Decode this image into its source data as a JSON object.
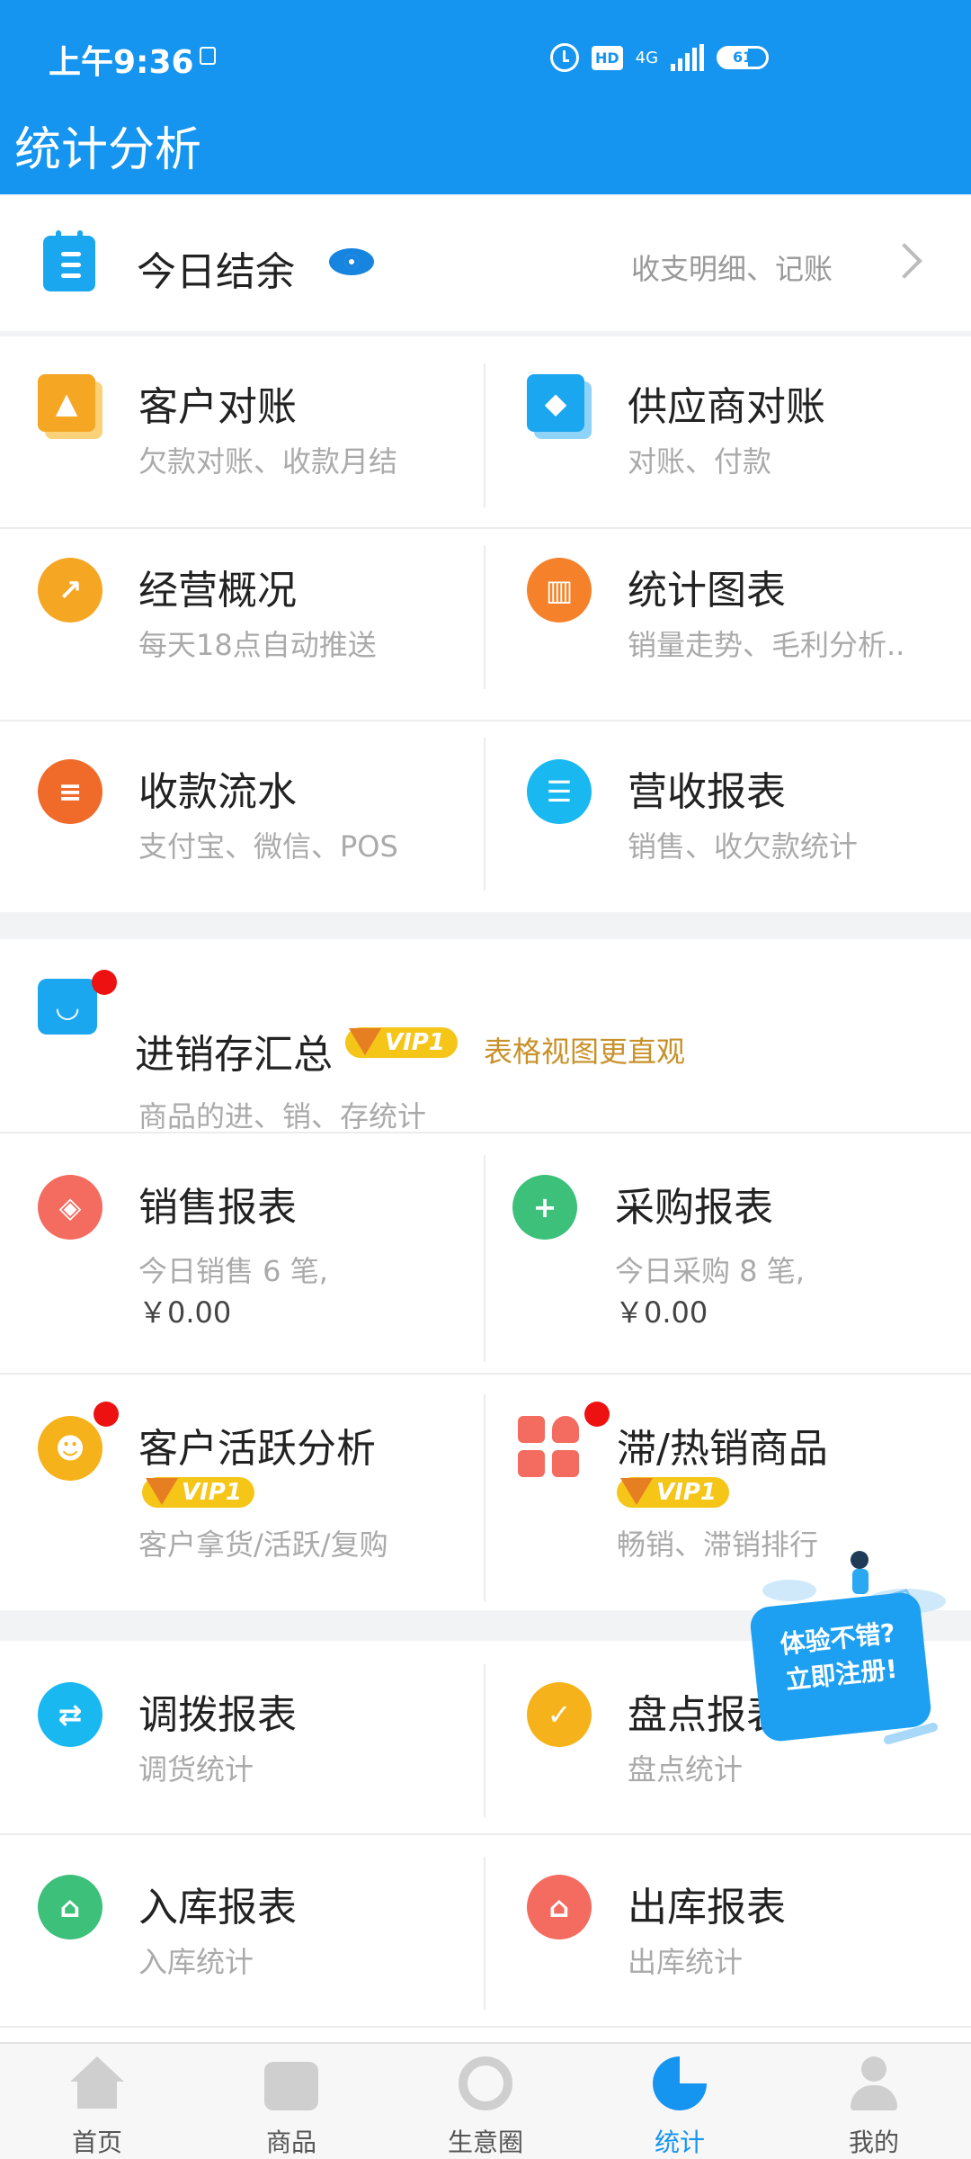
{
  "status_bar": {
    "time": "上午9:36",
    "hd": "HD",
    "network": "4G",
    "battery": "61"
  },
  "header": {
    "title": "统计分析"
  },
  "today": {
    "title": "今日结余",
    "subtitle": "收支明细、记账"
  },
  "grid1": [
    {
      "title": "客户对账",
      "subtitle": "欠款对账、收款月结"
    },
    {
      "title": "供应商对账",
      "subtitle": "对账、付款"
    },
    {
      "title": "经营概况",
      "subtitle": "每天18点自动推送"
    },
    {
      "title": "统计图表",
      "subtitle": "销量走势、毛利分析.."
    },
    {
      "title": "收款流水",
      "subtitle": "支付宝、微信、POS"
    },
    {
      "title": "营收报表",
      "subtitle": "销售、收欠款统计"
    }
  ],
  "inventory": {
    "title": "进销存汇总",
    "vip": "VIP1",
    "promo": "表格视图更直观",
    "subtitle": "商品的进、销、存统计"
  },
  "reports": [
    {
      "title": "销售报表",
      "line1": "今日销售 6 笔,",
      "line2": "￥0.00"
    },
    {
      "title": "采购报表",
      "line1": "今日采购 8 笔,",
      "line2": "￥0.00"
    },
    {
      "title": "客户活跃分析",
      "vip": "VIP1",
      "subtitle": "客户拿货/活跃/复购"
    },
    {
      "title": "滞/热销商品",
      "vip": "VIP1",
      "subtitle": "畅销、滞销排行"
    }
  ],
  "grid2": [
    {
      "title": "调拨报表",
      "subtitle": "调货统计"
    },
    {
      "title": "盘点报表",
      "subtitle": "盘点统计"
    },
    {
      "title": "入库报表",
      "subtitle": "入库统计"
    },
    {
      "title": "出库报表",
      "subtitle": "出库统计"
    }
  ],
  "promo_badge": {
    "line1": "体验不错?",
    "line2": "立即注册!"
  },
  "tabs": [
    {
      "label": "首页",
      "icon": "home-icon"
    },
    {
      "label": "商品",
      "icon": "bag-icon"
    },
    {
      "label": "生意圈",
      "icon": "circle-icon"
    },
    {
      "label": "统计",
      "icon": "pie-chart-icon"
    },
    {
      "label": "我的",
      "icon": "user-icon"
    }
  ],
  "colors": {
    "header": "#1595f0",
    "accent_blue": "#1aa7ef",
    "orange": "#f5a623",
    "red_orange": "#f06a2a",
    "coral": "#f46b5f",
    "green": "#3cc07a",
    "vip_gold": "#f5c518"
  }
}
